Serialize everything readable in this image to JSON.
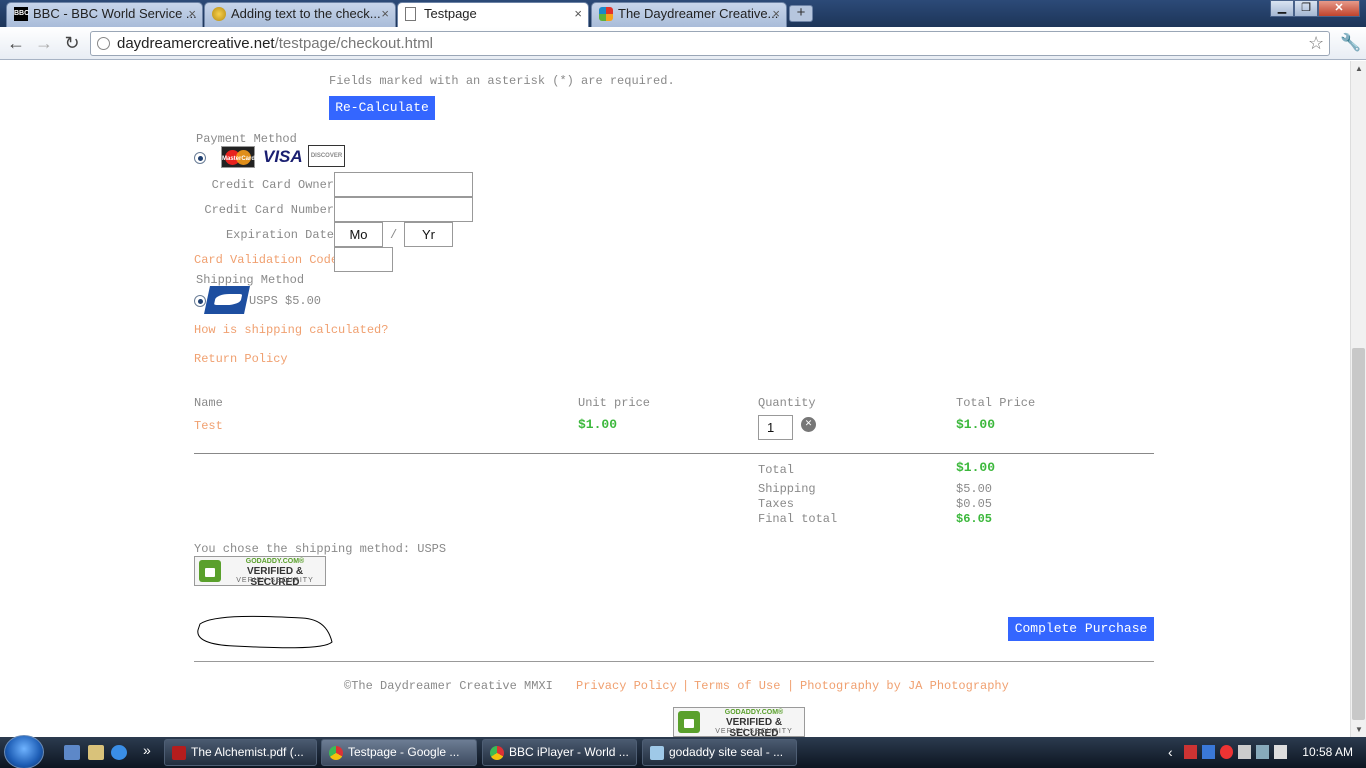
{
  "browser": {
    "tabs": [
      {
        "label": "BBC - BBC World Service ...",
        "icon": "bbc-icon",
        "active": false
      },
      {
        "label": "Adding text to the check...",
        "icon": "forum-icon",
        "active": false
      },
      {
        "label": "Testpage",
        "icon": "page-icon",
        "active": true
      },
      {
        "label": "The Daydreamer Creative...",
        "icon": "joomla-icon",
        "active": false
      }
    ],
    "tab_close_glyph": "×",
    "new_tab_glyph": "+",
    "url_host": "daydreamercreative.net",
    "url_path": "/testpage/checkout.html",
    "window_buttons": {
      "minimize": "▁",
      "maximize": "❐",
      "close": "✕"
    },
    "nav": {
      "back": "←",
      "forward": "→",
      "reload": "↻",
      "star": "☆",
      "wrench": "🔧"
    }
  },
  "checkout": {
    "required_note": "Fields marked with an asterisk (*) are required.",
    "recalculate_label": "Re-Calculate",
    "payment_method_label": "Payment Method",
    "cards": {
      "mastercard": "MasterCard",
      "visa": "VISA",
      "discover": "DISCOVER"
    },
    "fields": {
      "owner_label": "Credit Card Owner",
      "number_label": "Credit Card Number",
      "expiration_label": "Expiration Date",
      "month_value": "Mo",
      "separator": "/",
      "year_value": "Yr",
      "cvc_label": "Card Validation Code"
    },
    "shipping_method_label": "Shipping Method",
    "shipping_option": "USPS $5.00",
    "shipping_link": "How is shipping calculated?",
    "return_link": "Return Policy",
    "cart": {
      "headers": {
        "name": "Name",
        "unit_price": "Unit price",
        "quantity": "Quantity",
        "total_price": "Total Price"
      },
      "rows": [
        {
          "name": "Test",
          "unit_price": "$1.00",
          "quantity": "1",
          "total_price": "$1.00"
        }
      ],
      "remove_glyph": "✕"
    },
    "totals": {
      "total_label": "Total",
      "total_value": "$1.00",
      "shipping_label": "Shipping",
      "shipping_value": "$5.00",
      "taxes_label": "Taxes",
      "taxes_value": "$0.05",
      "final_label": "Final total",
      "final_value": "$6.05"
    },
    "chosen_shipping": "You chose the shipping method: USPS",
    "seal": {
      "top": "GODADDY.COM®",
      "mid": "VERIFIED & SECURED",
      "bottom": "VERIFY SECURITY"
    },
    "complete_label": "Complete Purchase"
  },
  "footer": {
    "copyright": "©The Daydreamer Creative MMXI",
    "links": [
      "Privacy Policy",
      "Terms of Use",
      "Photography by JA Photography"
    ],
    "separator": "|"
  },
  "taskbar": {
    "tasks": [
      {
        "label": "The Alchemist.pdf (...",
        "icon": "pdf-icon",
        "active": false
      },
      {
        "label": "Testpage - Google ...",
        "icon": "chrome-icon",
        "active": true
      },
      {
        "label": "BBC iPlayer - World ...",
        "icon": "chrome-icon",
        "active": false
      },
      {
        "label": "godaddy site seal - ...",
        "icon": "notepad-icon",
        "active": false
      }
    ],
    "quick_launch_more": "»",
    "tray_arrow": "‹",
    "clock": "10:58 AM"
  },
  "colors": {
    "accent_blue": "#3466ff",
    "link_orange": "#f0a070",
    "price_green": "#3cb83c"
  }
}
